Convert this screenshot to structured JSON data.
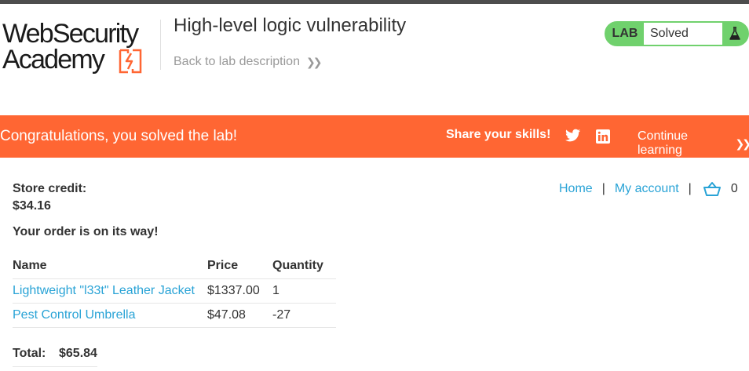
{
  "header": {
    "logo_line1": "WebSecurity",
    "logo_line2": "Academy",
    "lab_title": "High-level logic vulnerability",
    "back_link": "Back to lab description",
    "status_prefix": "LAB",
    "status_value": "Solved"
  },
  "banner": {
    "message": "Congratulations, you solved the lab!",
    "share_label": "Share your skills!",
    "continue_label": "Continue learning",
    "icons": [
      "twitter-icon",
      "linkedin-icon"
    ]
  },
  "nav": {
    "home": "Home",
    "separator": "|",
    "my_account": "My account",
    "cart_count": "0"
  },
  "account": {
    "credit_label": "Store credit:",
    "credit_value": "$34.16",
    "order_message": "Your order is on its way!"
  },
  "order": {
    "columns": [
      "Name",
      "Price",
      "Quantity"
    ],
    "rows": [
      {
        "name": "Lightweight \"l33t\" Leather Jacket",
        "price": "$1337.00",
        "quantity": "1"
      },
      {
        "name": "Pest Control Umbrella",
        "price": "$47.08",
        "quantity": "-27"
      }
    ],
    "total_label": "Total:",
    "total_value": "$65.84"
  },
  "colors": {
    "banner": "#ff6633",
    "status_green": "#70d16d",
    "link_blue": "#29a3d6",
    "logo_orange": "#ff6633"
  }
}
